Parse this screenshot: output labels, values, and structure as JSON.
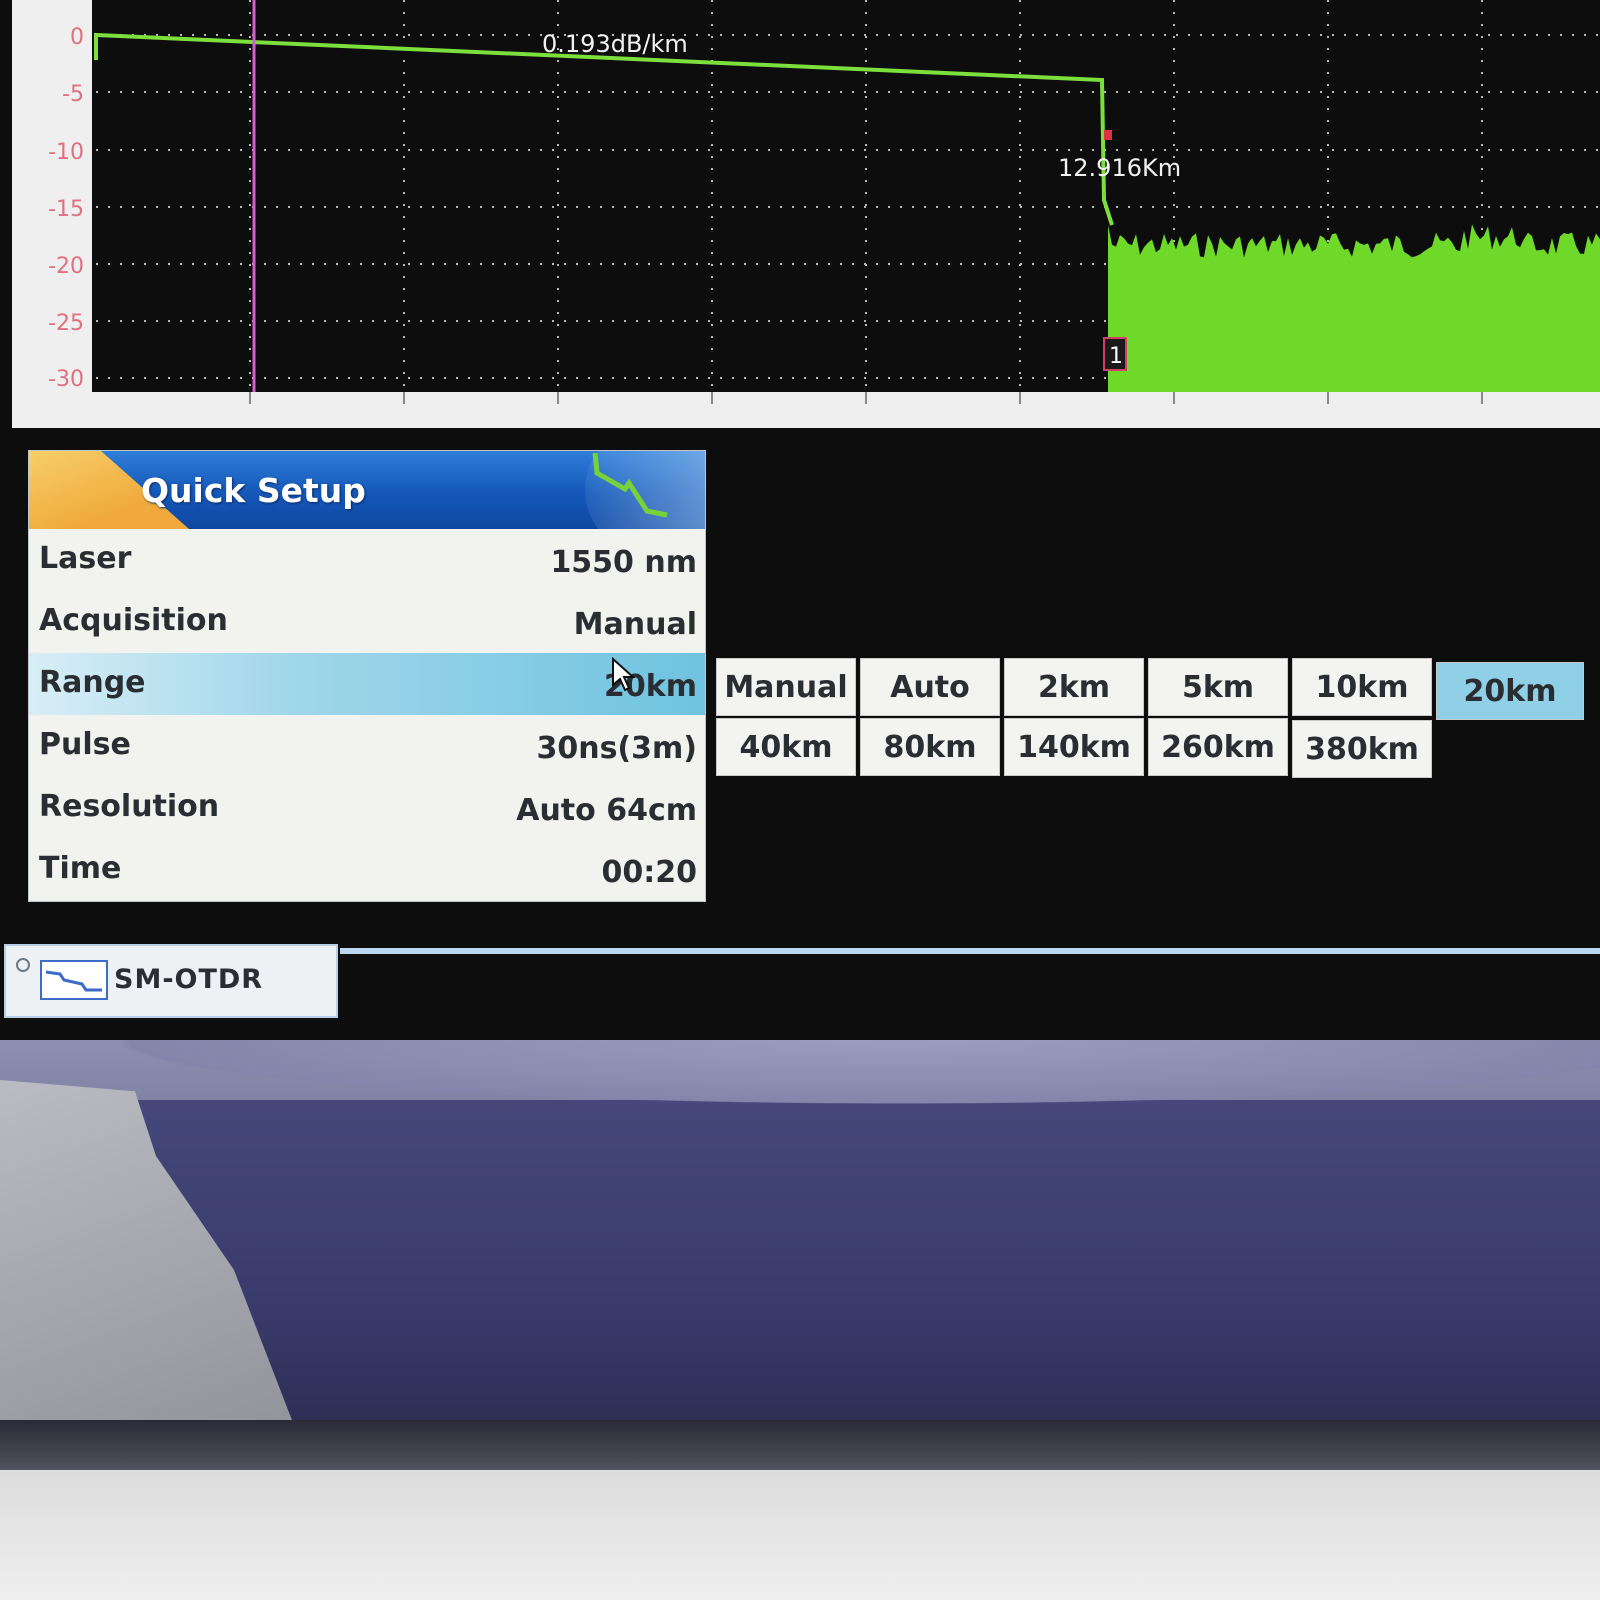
{
  "trace_plot": {
    "y_axis_ticks": [
      "0",
      "-5",
      "-10",
      "-15",
      "-20",
      "-25",
      "-30"
    ],
    "slope_label": "0.193dB/km",
    "event_distance_label": "12.916Km",
    "event_marker_label": "1",
    "colors": {
      "background": "#0d0d0d",
      "trace": "#7be03c",
      "noise_fill": "#6fd92a",
      "cursor": "#d060d0",
      "grid": "#b8b8b8",
      "tick_label": "#e07080"
    }
  },
  "quick_setup": {
    "title": "Quick Setup",
    "rows": [
      {
        "label": "Laser",
        "value": "1550 nm",
        "selected": false
      },
      {
        "label": "Acquisition",
        "value": "Manual",
        "selected": false
      },
      {
        "label": "Range",
        "value": "20km",
        "selected": true
      },
      {
        "label": "Pulse",
        "value": "30ns(3m)",
        "selected": false
      },
      {
        "label": "Resolution",
        "value": "Auto 64cm",
        "selected": false
      },
      {
        "label": "Time",
        "value": "00:20",
        "selected": false
      }
    ]
  },
  "range_options": {
    "row1": [
      "Manual",
      "Auto",
      "2km",
      "5km",
      "10km",
      "20km"
    ],
    "row2": [
      "40km",
      "80km",
      "140km",
      "260km",
      "380km"
    ],
    "selected": "20km"
  },
  "tabs": [
    {
      "label": "SM-OTDR",
      "icon": "otdr-trace-icon",
      "active": true
    }
  ]
}
